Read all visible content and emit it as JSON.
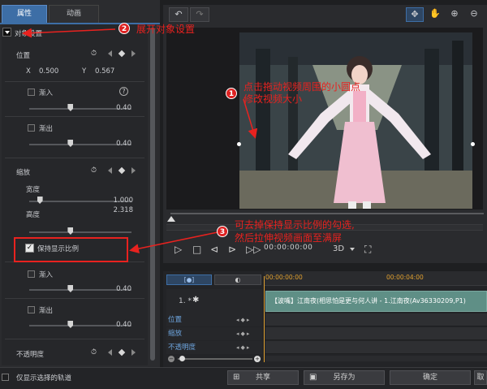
{
  "tabs": {
    "properties": "属性",
    "animation": "动画"
  },
  "object_settings": {
    "label": "对象设置"
  },
  "position": {
    "label": "位置",
    "x_label": "X",
    "x_value": "0.500",
    "y_label": "Y",
    "y_value": "0.567"
  },
  "fade_in_1": {
    "label": "渐入",
    "value": "0.40",
    "level": 0.4
  },
  "fade_out_1": {
    "label": "渐出",
    "value": "0.40",
    "level": 0.4
  },
  "scale": {
    "label": "缩放",
    "width_label": "宽度",
    "width_value": "1.000",
    "width_level": 0.1,
    "height_label": "高度",
    "height_value": "2.318",
    "height_level": 0.4,
    "keep_ratio_label": "保持显示比例",
    "keep_ratio_checked": true
  },
  "fade_in_2": {
    "label": "渐入",
    "value": "0.40",
    "level": 0.4
  },
  "fade_out_2": {
    "label": "渐出",
    "value": "0.40",
    "level": 0.4
  },
  "opacity": {
    "label": "不透明度"
  },
  "help_symbol": "?",
  "preview": {
    "timecode": "00:00:00:00",
    "mode": "3D",
    "undo": "↶",
    "redo": "↷"
  },
  "timeline": {
    "head_tab1": "[●]",
    "track_name": "1. *",
    "ruler_start": "00:00:00:00",
    "ruler_mid": "00:00:04:00",
    "clip_title": "【波嘴】江南夜(相思怕是更与何人讲 - 1.江南夜(Av36330209,P1)",
    "lanes": [
      "位置",
      "缩放",
      "不透明度"
    ]
  },
  "bottom": {
    "only_selected": "仅显示选择的轨道",
    "share": "共享",
    "save_as": "另存为",
    "ok": "确定",
    "cancel": "取消"
  },
  "annotations": {
    "a1_num": "1",
    "a1_text_l1": "点击拖动视频周围的小圆点",
    "a1_text_l2": "修改视频大小",
    "a2_num": "2",
    "a2_text": "展开对象设置",
    "a3_num": "3",
    "a3_text_l1": "可去掉保持显示比例的勾选,",
    "a3_text_l2": "然后拉伸视频画面至满屏"
  },
  "colors": {
    "accent": "#3d6ea6",
    "annotation": "#e8221f",
    "clip": "#5f8f86",
    "playhead": "#e0a030"
  }
}
